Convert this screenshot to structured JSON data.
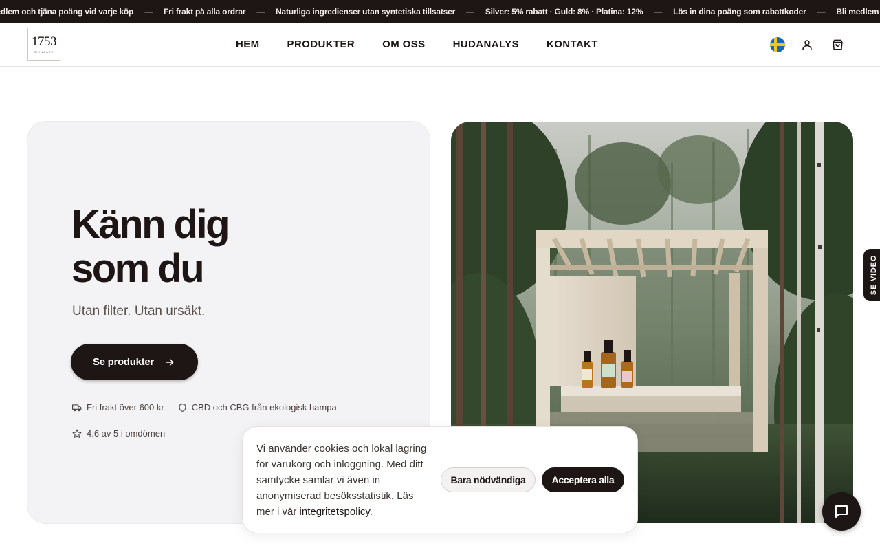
{
  "ticker": {
    "items": [
      "medlem och tjäna poäng vid varje köp",
      "Fri frakt på alla ordrar",
      "Naturliga ingredienser utan syntetiska tillsatser",
      "Silver: 5% rabatt · Guld: 8% · Platina: 12%",
      "Lös in dina poäng som rabattkoder",
      "Bli medlem och tjä"
    ],
    "separator": "—"
  },
  "header": {
    "logo_number": "1753",
    "logo_subtext": "SKINCARE",
    "nav": [
      "HEM",
      "PRODUKTER",
      "OM OSS",
      "HUDANALYS",
      "KONTAKT"
    ]
  },
  "hero": {
    "title_line1": "Känn dig",
    "title_line2": "som du",
    "subtitle": "Utan filter. Utan ursäkt.",
    "cta_label": "Se produkter",
    "usp_shipping": "Fri frakt över 600 kr",
    "usp_hemp": "CBD och CBG från ekologisk hampa",
    "rating_text": "4.6 av 5 i omdömen"
  },
  "video_tab": {
    "label": "SE VIDEO"
  },
  "cookie": {
    "text": "Vi använder cookies och lokal lagring för varukorg och inloggning. Med ditt samtycke samlar vi även in anonymiserad besöksstatistik. Läs mer i vår ",
    "link_text": "integritetspolicy",
    "text_end": ".",
    "btn_necessary": "Bara nödvändiga",
    "btn_accept": "Acceptera alla"
  },
  "colors": {
    "primary": "#1e1614",
    "hero_card_bg": "#f3f2f4",
    "flag_blue": "#1968b6",
    "flag_yellow": "#f2c521"
  },
  "icons": {
    "account": "user-icon",
    "cart": "shopping-bag-icon",
    "language": "sweden-flag-icon",
    "chat": "chat-icon",
    "shipping": "truck-icon",
    "hemp": "shield-icon",
    "rating": "star-icon",
    "cta": "arrow-right-icon"
  }
}
